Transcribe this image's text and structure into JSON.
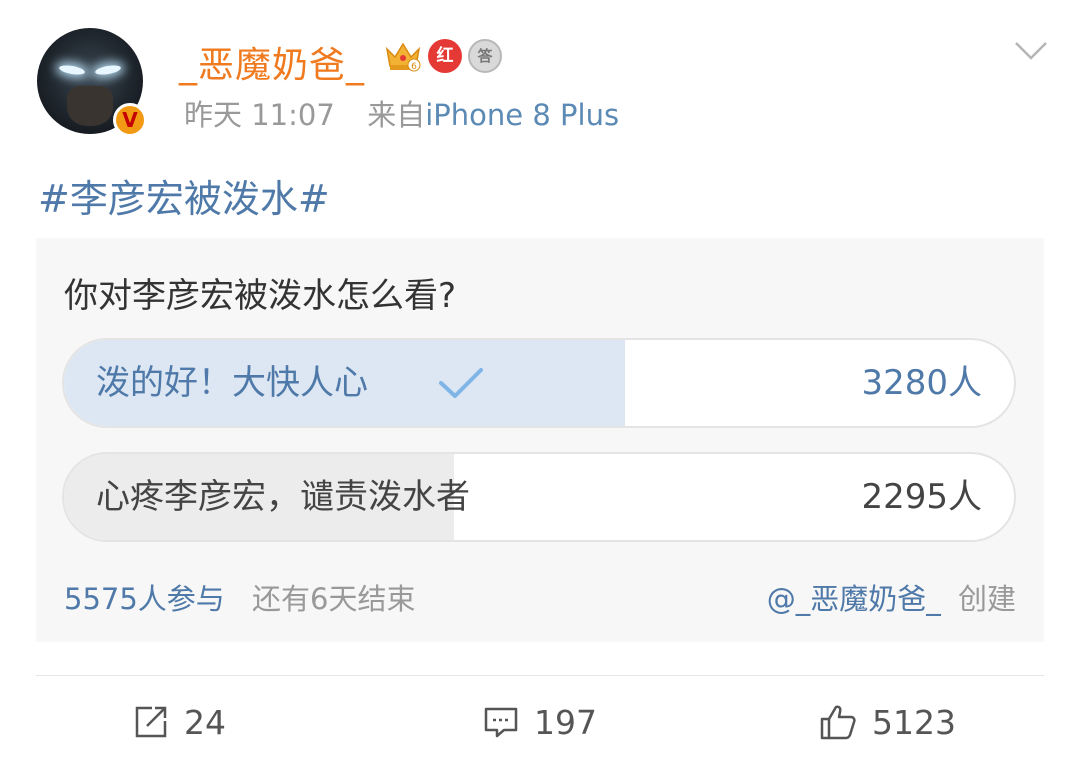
{
  "post": {
    "username": "_恶魔奶爸_",
    "avatar_badge": "V",
    "badges": {
      "red_label": "红",
      "silver_label": "答"
    },
    "time": "昨天 11:07",
    "source_prefix": "来自",
    "source": "iPhone 8 Plus",
    "topic": "#李彦宏被泼水#"
  },
  "poll": {
    "question": "你对李彦宏被泼水怎么看?",
    "options": [
      {
        "label": "泼的好！大快人心",
        "count": "3280人",
        "share": 0.59,
        "selected": true
      },
      {
        "label": "心疼李彦宏，谴责泼水者",
        "count": "2295人",
        "share": 0.41,
        "selected": false
      }
    ],
    "participants": "5575人参与",
    "remaining": "还有6天结束",
    "creator": "@_恶魔奶爸_",
    "created_label": "创建"
  },
  "actions": {
    "share_count": "24",
    "comment_count": "197",
    "like_count": "5123"
  },
  "colors": {
    "username": "#f07a1f",
    "link": "#4f79a8",
    "selected_fill": "#dce7f3",
    "unselected_fill": "#ececec"
  }
}
